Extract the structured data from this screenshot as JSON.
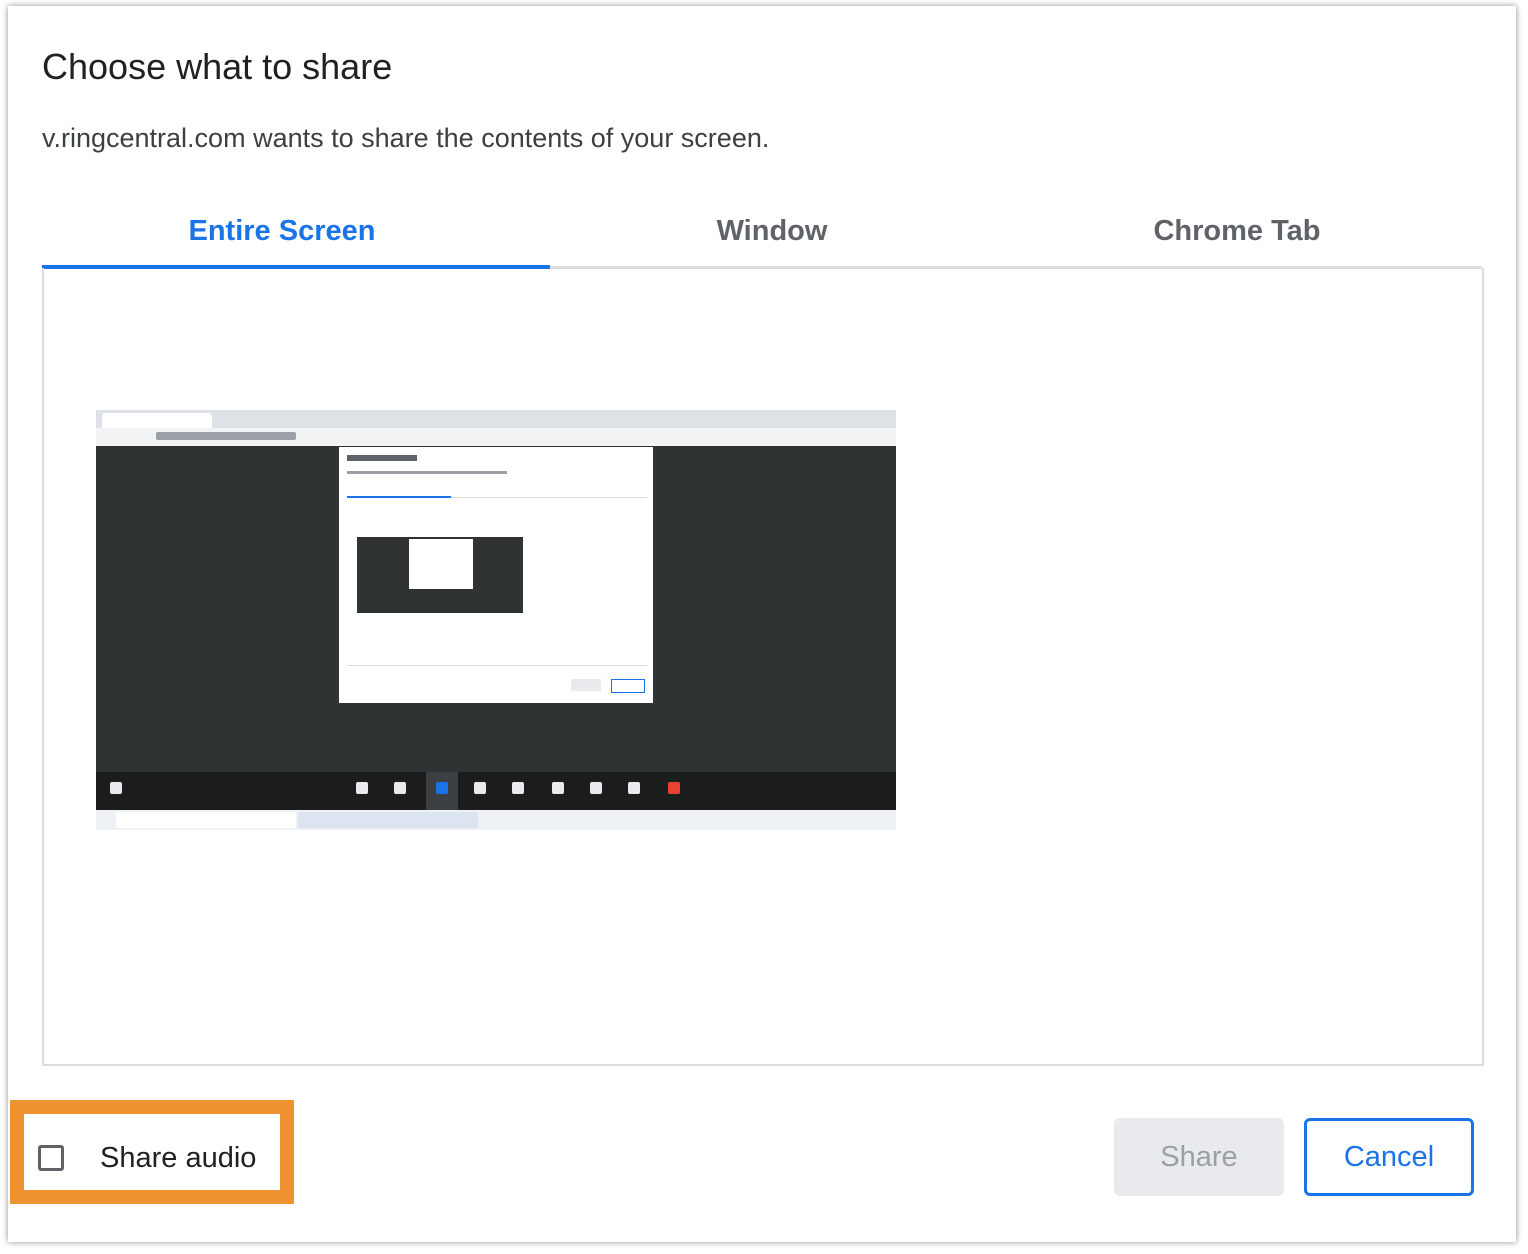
{
  "dialog": {
    "title": "Choose what to share",
    "subtitle": "v.ringcentral.com wants to share the contents of your screen."
  },
  "tabs": [
    {
      "label": "Entire Screen",
      "active": true
    },
    {
      "label": "Window",
      "active": false
    },
    {
      "label": "Chrome Tab",
      "active": false
    }
  ],
  "preview": {
    "thumbnail_icon": "screen-thumbnail"
  },
  "footer": {
    "share_audio_label": "Share audio",
    "share_audio_checked": false,
    "share_label": "Share",
    "cancel_label": "Cancel"
  },
  "colors": {
    "accent": "#1a73e8",
    "highlight": "#f0922f",
    "disabled": "#e8eaed"
  }
}
